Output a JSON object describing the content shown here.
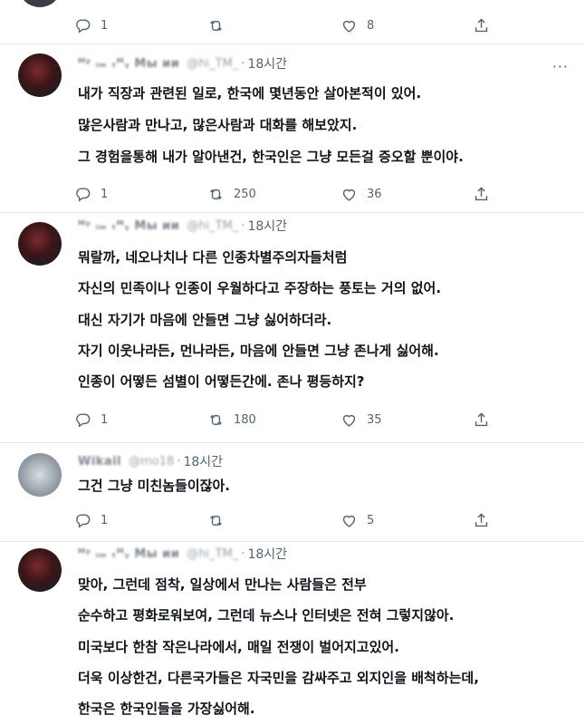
{
  "colors": {
    "text": "#0f1419",
    "muted": "#536471",
    "divider": "#e6e9eb"
  },
  "icons": {
    "reply": "reply-icon",
    "retweet": "retweet-icon",
    "like": "heart-icon",
    "share": "share-icon",
    "more": "more-icon"
  },
  "more_glyph": "···",
  "top_partial": {
    "replies": "1",
    "retweets": "",
    "likes": "8"
  },
  "tweets": [
    {
      "name": "ᴹʸ ᵢₘ ₜᴹᵧ Mы ии",
      "handle": "@hi_TM_",
      "time": "18시간",
      "lines": [
        "내가 직장과 관련된 일로, 한국에 몇년동안 살아본적이 있어.",
        "많은사람과 만나고, 많은사람과 대화를 해보았지.",
        "그 경험을통해 내가 알아낸건, 한국인은 그냥 모든걸 증오할 뿐이야."
      ],
      "replies": "1",
      "retweets": "250",
      "likes": "36"
    },
    {
      "name": "ᴹʸ ᵢₘ ₜᴹᵧ Mы ии",
      "handle": "@hi_TM_",
      "time": "18시간",
      "lines": [
        "뭐랄까, 네오나치나 다른 인종차별주의자들처럼",
        "자신의 민족이나 인종이 우월하다고 주장하는 풍토는 거의 없어.",
        "대신 자기가 마음에 안들면 그냥 싫어하더라.",
        "자기 이웃나라든, 먼나라든, 마음에 안들면 그냥 존나게 싫어해.",
        "인종이 어떻든 섬별이 어떻든간에. 존나 평등하지?"
      ],
      "replies": "1",
      "retweets": "180",
      "likes": "35"
    },
    {
      "name": "Wikail",
      "handle": "@mo18",
      "time": "18시간",
      "lines": [
        "그건 그냥 미친놈들이잖아."
      ],
      "replies": "1",
      "retweets": "",
      "likes": "5"
    },
    {
      "name": "ᴹʸ ᵢₘ ₜᴹᵧ Mы ии",
      "handle": "@hi_TM_",
      "time": "18시간",
      "lines": [
        "맞아, 그런데 점착, 일상에서 만나는 사람들은 전부",
        "순수하고 평화로워보여, 그런데 뉴스나 인터넷은 전혀 그렇지않아.",
        "미국보다 한참 작은나라에서, 매일 전쟁이 벌어지고있어.",
        "더욱 이상한건, 다른국가들은 자국민을 감싸주고 외지인을 배척하는데,",
        "한국은 한국인들을 가장싫어해."
      ]
    }
  ]
}
